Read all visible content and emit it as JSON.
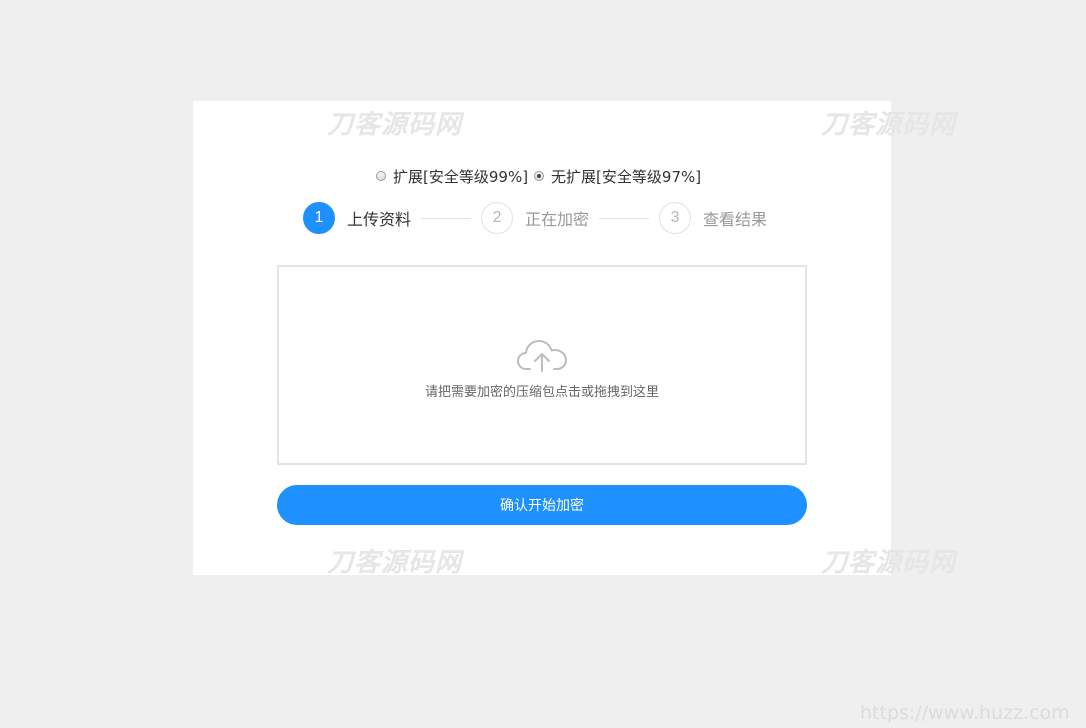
{
  "watermark": {
    "text": "刀客源码网",
    "footer": "https://www.huzz.com"
  },
  "mode": {
    "options": [
      {
        "label": "扩展[安全等级99%]",
        "checked": false
      },
      {
        "label": "无扩展[安全等级97%]",
        "checked": true
      }
    ]
  },
  "steps": [
    {
      "number": "1",
      "label": "上传资料",
      "active": true
    },
    {
      "number": "2",
      "label": "正在加密",
      "active": false
    },
    {
      "number": "3",
      "label": "查看结果",
      "active": false
    }
  ],
  "dropzone": {
    "icon": "cloud-upload-icon",
    "text": "请把需要加密的压缩包点击或拖拽到这里"
  },
  "submit": {
    "label": "确认开始加密"
  },
  "colors": {
    "accent": "#1e90ff",
    "background": "#efefef",
    "card": "#ffffff"
  }
}
